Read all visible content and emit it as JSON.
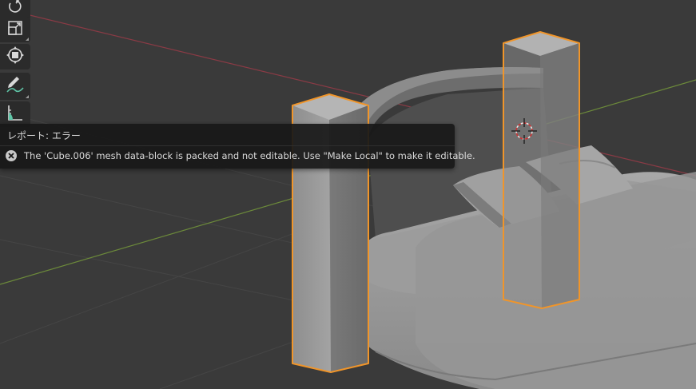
{
  "toolbar": {
    "tools": [
      {
        "icon": "rotate-icon"
      },
      {
        "icon": "scale-icon"
      },
      {
        "icon": "transform-icon"
      },
      {
        "icon": "annotate-icon"
      },
      {
        "icon": "measure-icon"
      }
    ]
  },
  "report": {
    "title": "レポート: エラー",
    "icon": "error-icon",
    "message": "The 'Cube.006' mesh data-block is packed and not editable. Use \"Make Local\" to make it editable."
  },
  "colors": {
    "viewport_bg": "#3a3a3a",
    "x_axis": "#8a3a45",
    "y_axis": "#6c8a3a",
    "selection": "#f0952a",
    "panel_bg": "#181818",
    "text": "#d9d9d9"
  }
}
